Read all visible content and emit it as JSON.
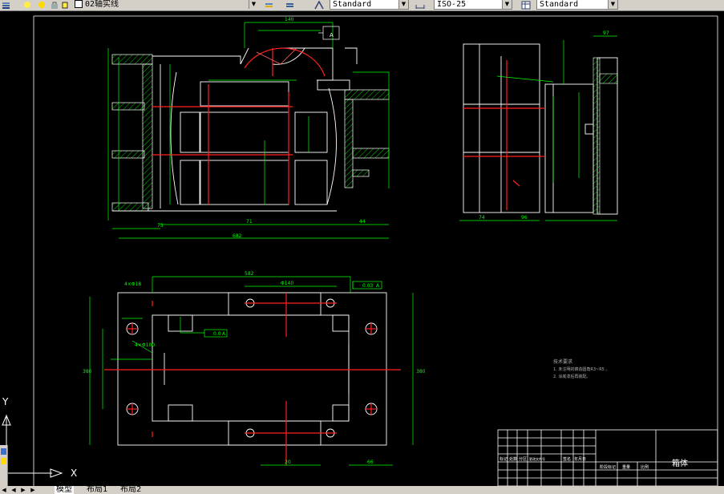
{
  "toolbar": {
    "layer_name": "02轴实线",
    "text_style": "Standard",
    "dim_style": "ISO-25",
    "table_style": "Standard"
  },
  "drawing": {
    "title_block_name": "箱体",
    "tech_requirements": {
      "heading": "技术要求",
      "line1": "1. 未注明的铸造圆角R3~R5 。",
      "line2": "2. 涂底漆后再装配。"
    },
    "dims": {
      "overall_width_front": "682",
      "bottom_right": "44",
      "left_bottom": "75",
      "mid_bottom": "71",
      "top_140": "140",
      "side_top": "97",
      "side_bottom_left": "74",
      "side_bottom_mid": "96",
      "plan_top": "582",
      "plan_mid": "Φ140",
      "plan_right": "380",
      "plan_left": "380",
      "plan_bottom_right": "66",
      "plan_bottom_left": "20",
      "plan_holes": "4×Φ18",
      "plan_holes2": "4×Φ100",
      "gdt1": "0.03",
      "gdt1_datum": "A",
      "gdt2": "0.0",
      "gdt2_datum": "A",
      "datum_label": "A"
    },
    "title_block_labels": {
      "c1": "标记",
      "c2": "处数",
      "c3": "分区",
      "c4": "更改文件号",
      "c5": "签名",
      "c6": "年月日",
      "c7": "阶段标记",
      "c8": "重量",
      "c9": "比例"
    }
  },
  "ucs": {
    "x_label": "X",
    "y_label": "Y"
  },
  "tabs": {
    "model": "模型",
    "layout1": "布局1",
    "layout2": "布局2"
  },
  "colors": {
    "background": "#000000",
    "outline": "#ffffff",
    "dimension": "#00ff00",
    "centerline": "#ff0000",
    "hatch": "#00ff00"
  }
}
